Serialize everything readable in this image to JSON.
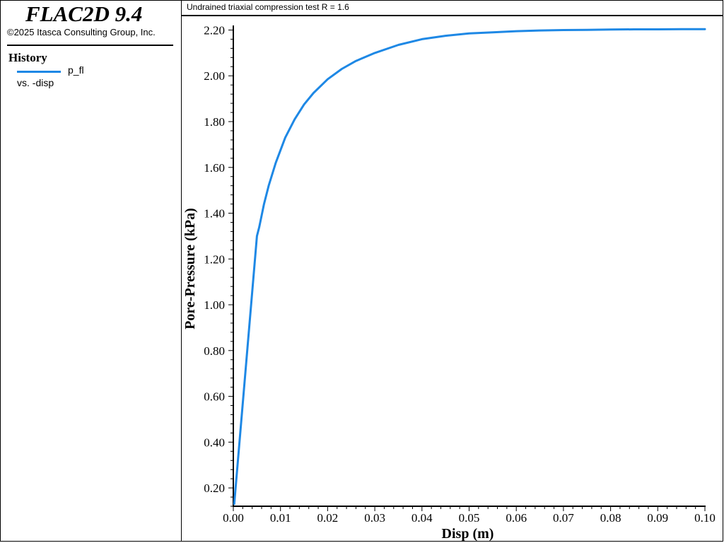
{
  "app": {
    "title": "FLAC2D 9.4",
    "copyright": "©2025 Itasca Consulting Group, Inc."
  },
  "legend": {
    "heading": "History",
    "series_name": "p_fl",
    "versus": "vs. -disp",
    "color": "#1e88e5"
  },
  "chart_data": {
    "type": "line",
    "title": "Undrained triaxial compression test R = 1.6",
    "xlabel": "Disp (m)",
    "ylabel": "Pore-Pressure (kPa)",
    "xlim": [
      0.0,
      0.1
    ],
    "ylim": [
      0.12,
      2.22
    ],
    "grid": false,
    "x_ticks": [
      0.0,
      0.01,
      0.02,
      0.03,
      0.04,
      0.05,
      0.06,
      0.07,
      0.08,
      0.09,
      0.1
    ],
    "x_tick_labels": [
      "0.00",
      "0.01",
      "0.02",
      "0.03",
      "0.04",
      "0.05",
      "0.06",
      "0.07",
      "0.08",
      "0.09",
      "0.10"
    ],
    "y_ticks": [
      0.2,
      0.4,
      0.6,
      0.8,
      1.0,
      1.2,
      1.4,
      1.6,
      1.8,
      2.0,
      2.2
    ],
    "y_tick_labels": [
      "0.20",
      "0.40",
      "0.60",
      "0.80",
      "1.00",
      "1.20",
      "1.40",
      "1.60",
      "1.80",
      "2.00",
      "2.20"
    ],
    "series": [
      {
        "name": "p_fl",
        "color": "#1e88e5",
        "x": [
          0.0002,
          0.005,
          0.0055,
          0.0065,
          0.0075,
          0.009,
          0.011,
          0.013,
          0.015,
          0.017,
          0.02,
          0.023,
          0.026,
          0.03,
          0.035,
          0.04,
          0.045,
          0.05,
          0.055,
          0.06,
          0.065,
          0.07,
          0.075,
          0.08,
          0.085,
          0.09,
          0.095,
          0.1
        ],
        "y": [
          0.13,
          1.3,
          1.34,
          1.44,
          1.52,
          1.62,
          1.73,
          1.81,
          1.875,
          1.925,
          1.985,
          2.03,
          2.065,
          2.1,
          2.135,
          2.16,
          2.175,
          2.185,
          2.19,
          2.195,
          2.198,
          2.2,
          2.201,
          2.202,
          2.203,
          2.203,
          2.204,
          2.204
        ]
      }
    ]
  }
}
